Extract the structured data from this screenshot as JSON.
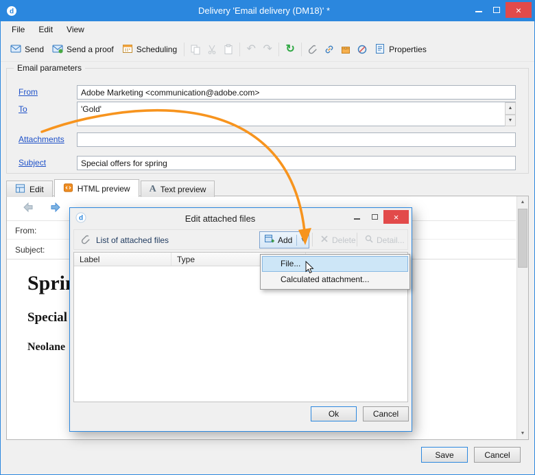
{
  "window": {
    "title": "Delivery 'Email delivery (DM18)' *"
  },
  "menu": [
    "File",
    "Edit",
    "View"
  ],
  "toolbar": {
    "send": "Send",
    "send_proof": "Send a proof",
    "scheduling": "Scheduling",
    "properties": "Properties"
  },
  "params": {
    "legend": "Email parameters",
    "from_label": "From",
    "from_value": "Adobe Marketing <communication@adobe.com>",
    "to_label": "To",
    "to_value": "'Gold'",
    "attachments_label": "Attachments",
    "attachments_value": "",
    "subject_label": "Subject",
    "subject_value": "Special offers for spring"
  },
  "tabs": [
    "Edit",
    "HTML preview",
    "Text preview"
  ],
  "preview": {
    "from_label": "From:",
    "subject_label": "Subject:",
    "line1": "Spring",
    "line2": "Special",
    "line3": "Neolane"
  },
  "dialog": {
    "title": "Edit attached files",
    "list_label": "List of attached files",
    "add_label": "Add",
    "delete_label": "Delete",
    "detail_label": "Detail...",
    "col_label": "Label",
    "col_type": "Type",
    "menu": [
      "File...",
      "Calculated attachment..."
    ],
    "ok": "Ok",
    "cancel": "Cancel"
  },
  "footer": {
    "save": "Save",
    "cancel": "Cancel"
  },
  "colors": {
    "titlebar_blue": "#2b87de",
    "close_red": "#e24a4a",
    "link_blue": "#1d50c8",
    "arrow_orange": "#f7941e",
    "menu_highlight": "#cde6f7"
  }
}
